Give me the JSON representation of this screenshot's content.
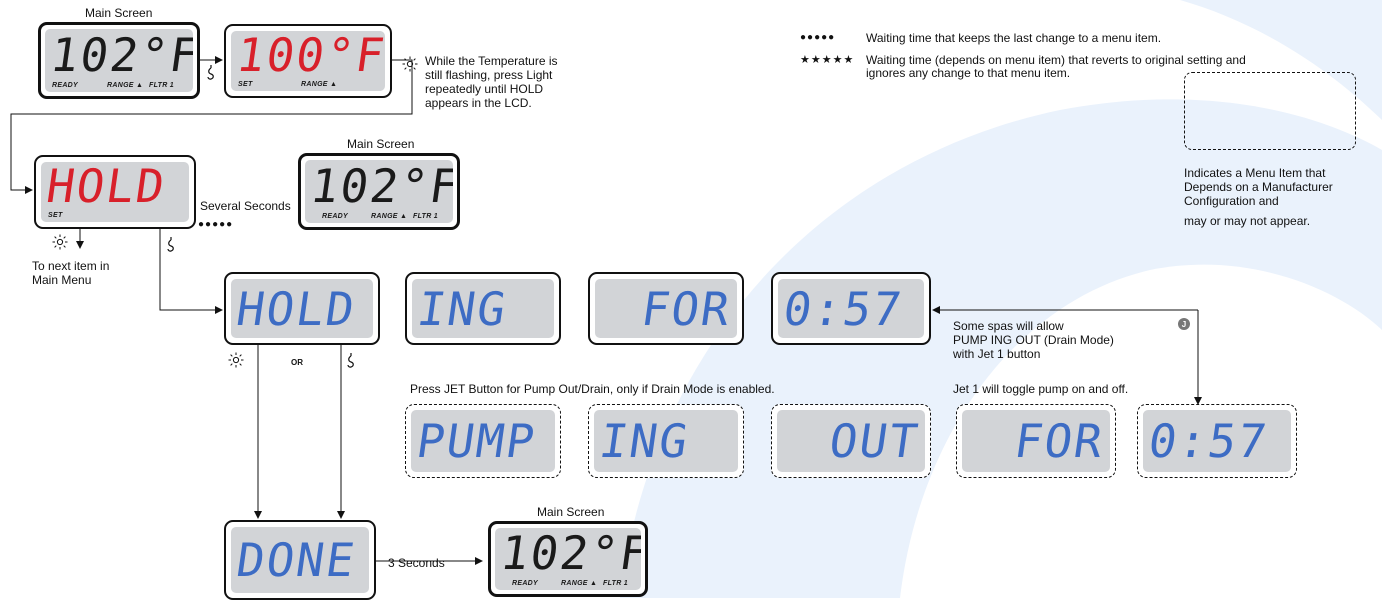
{
  "legend": {
    "dots_symbol": "●●●●●",
    "dots_text": "Waiting time that keeps the last change to a menu item.",
    "stars_symbol": "★★★★★",
    "stars_text_1": "Waiting time (depends on menu item) that reverts to original setting and",
    "stars_text_2": "ignores any change to that menu item.",
    "box_text_1": "Indicates a Menu Item that",
    "box_text_2": "Depends on a Manufacturer",
    "box_text_3": "Configuration and",
    "box_text_4": "may or may not appear."
  },
  "labels": {
    "main_screen_1": "Main Screen",
    "main_screen_2": "Main Screen",
    "main_screen_3": "Main Screen",
    "flash_note_1": "While the Temperature is",
    "flash_note_2": "still flashing, press Light",
    "flash_note_3": "repeatedly until HOLD",
    "flash_note_4": "appears in the LCD.",
    "several_seconds": "Several Seconds",
    "dots": "●●●●●",
    "next_item_1": "To next item in",
    "next_item_2": "Main Menu",
    "or": "OR",
    "drain_note_1": "Some spas will allow",
    "drain_note_2": "PUMP ING OUT (Drain Mode)",
    "drain_note_3": "with Jet 1 button",
    "press_jet": "Press JET Button for Pump Out/Drain, only if Drain Mode is enabled.",
    "jet1_toggle": "Jet 1 will toggle pump on and off.",
    "three_seconds": "3 Seconds",
    "jet_badge": "J"
  },
  "lcds": {
    "main1": {
      "text": "102°F",
      "ready": "READY",
      "range": "RANGE ▲",
      "fltr": "FLTR 1"
    },
    "set100": {
      "text": "100°F",
      "set": "SET",
      "range": "RANGE ▲"
    },
    "hold_red": {
      "text": "HOLD",
      "set": "SET"
    },
    "main2": {
      "text": "102°F",
      "ready": "READY",
      "range": "RANGE ▲",
      "fltr": "FLTR 1"
    },
    "hold_blue": {
      "text": "HOLD"
    },
    "ing1": {
      "text": "ING"
    },
    "for1": {
      "text": "FOR"
    },
    "time1": {
      "text": "0:57"
    },
    "pump": {
      "text": "PUMP"
    },
    "ing2": {
      "text": "ING"
    },
    "out": {
      "text": "OUT"
    },
    "for2": {
      "text": "FOR"
    },
    "time2": {
      "text": "0:57"
    },
    "done": {
      "text": "DONE"
    },
    "main3": {
      "text": "102°F",
      "ready": "READY",
      "range": "RANGE ▲",
      "fltr": "FLTR 1"
    }
  },
  "colors": {
    "lcd_background": "#d2d4d7",
    "segment_red": "#d8202a",
    "segment_blue": "#3d6cc4",
    "segment_black": "#1a1a1a",
    "watermark": "#e6f0fb"
  },
  "icons": [
    "light-icon",
    "jet-icon",
    "arrow-right-icon",
    "arrow-down-icon",
    "arrow-left-icon"
  ]
}
